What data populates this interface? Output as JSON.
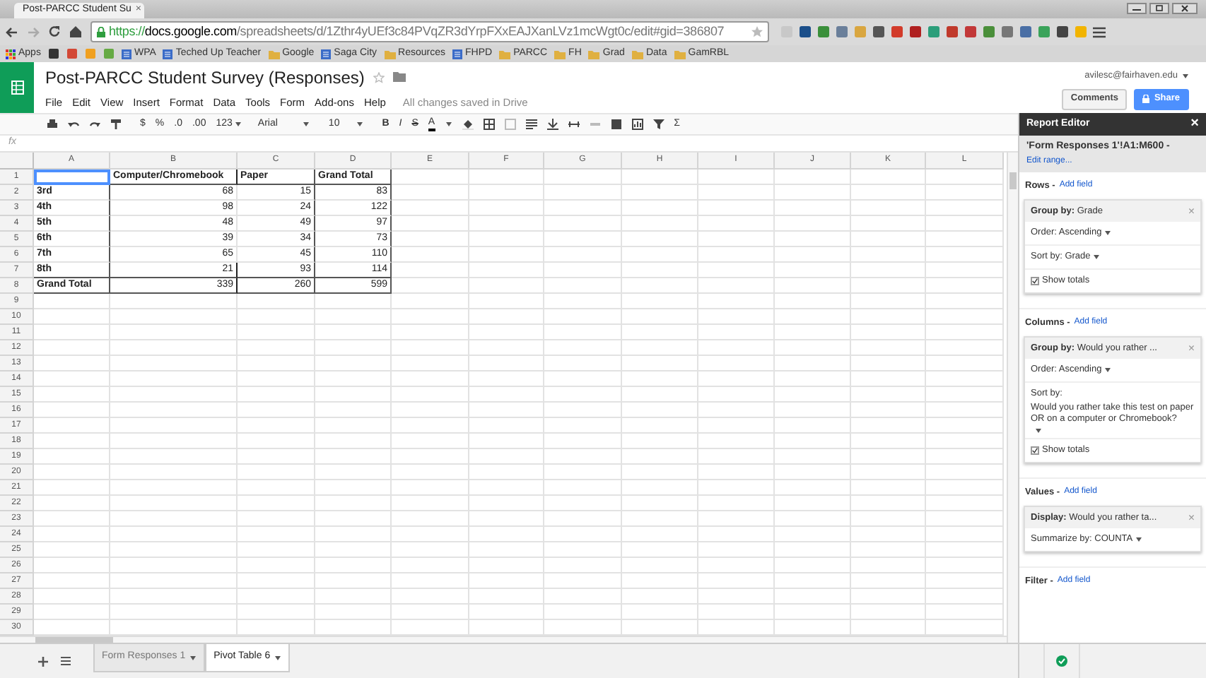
{
  "browser": {
    "tab_title": "Post-PARCC Student Su",
    "tab_close": "×",
    "url_scheme": "https://",
    "url_host": "docs.google.com",
    "url_path": "/spreadsheets/d/1Zthr4yUEf3c84PVqZR3dYrpFXxEAJXanLVz1mcWgt0c/edit#gid=386807",
    "bookmarks": [
      {
        "kind": "apps",
        "label": "Apps"
      },
      {
        "kind": "page",
        "label": "WPA"
      },
      {
        "kind": "page",
        "label": "Teched Up Teacher"
      },
      {
        "kind": "folder",
        "label": "Google"
      },
      {
        "kind": "page",
        "label": "Saga City"
      },
      {
        "kind": "folder",
        "label": "Resources"
      },
      {
        "kind": "page",
        "label": "FHPD"
      },
      {
        "kind": "folder",
        "label": "PARCC"
      },
      {
        "kind": "folder",
        "label": "FH"
      },
      {
        "kind": "folder",
        "label": "Grad"
      },
      {
        "kind": "folder",
        "label": "Data"
      },
      {
        "kind": "folder",
        "label": "GamRBL"
      }
    ]
  },
  "doc": {
    "title": "Post-PARCC Student Survey (Responses)",
    "menus": [
      "File",
      "Edit",
      "View",
      "Insert",
      "Format",
      "Data",
      "Tools",
      "Form",
      "Add-ons",
      "Help"
    ],
    "save_status": "All changes saved in Drive",
    "account": "avilesc@fairhaven.edu",
    "comments_button": "Comments",
    "share_button": "Share"
  },
  "toolbar": {
    "texts": [
      "$",
      "%",
      ".0",
      ".00",
      "123",
      "Arial",
      "10",
      "B",
      "I",
      "S",
      "A",
      "Σ"
    ]
  },
  "formula_bar": {
    "label": "fx"
  },
  "grid": {
    "columns": [
      "A",
      "B",
      "C",
      "D",
      "E",
      "F",
      "G",
      "H",
      "I",
      "J",
      "K",
      "L"
    ],
    "row_numbers": [
      "1",
      "2",
      "3",
      "4",
      "5",
      "6",
      "7",
      "8",
      "9",
      "10",
      "11",
      "12",
      "13",
      "14",
      "15",
      "16",
      "17",
      "18",
      "19",
      "20",
      "21",
      "22",
      "23",
      "24",
      "25",
      "26",
      "27",
      "28",
      "29",
      "30"
    ],
    "rows": [
      [
        {
          "selected": true
        },
        {
          "text": "Computer/Chromebook",
          "selected": false
        },
        {
          "text": "Paper",
          "selected": false
        },
        {
          "text": "Grand Total",
          "selected": false
        }
      ],
      [
        {
          "text": "3rd",
          "selected": false
        },
        {
          "text": "68",
          "selected": false
        },
        {
          "text": "15",
          "selected": false
        },
        {
          "text": "83",
          "selected": false
        }
      ],
      [
        {
          "text": "4th",
          "selected": false
        },
        {
          "text": "98",
          "selected": false
        },
        {
          "text": "24",
          "selected": false
        },
        {
          "text": "122",
          "selected": false
        }
      ],
      [
        {
          "text": "5th",
          "selected": false
        },
        {
          "text": "48",
          "selected": false
        },
        {
          "text": "49",
          "selected": false
        },
        {
          "text": "97",
          "selected": false
        }
      ],
      [
        {
          "text": "6th",
          "selected": false
        },
        {
          "text": "39",
          "selected": false
        },
        {
          "text": "34",
          "selected": false
        },
        {
          "text": "73",
          "selected": false
        }
      ],
      [
        {
          "text": "7th",
          "selected": false
        },
        {
          "text": "65",
          "selected": false
        },
        {
          "text": "45",
          "selected": false
        },
        {
          "text": "110",
          "selected": false
        }
      ],
      [
        {
          "text": "8th",
          "selected": false
        },
        {
          "text": "21",
          "selected": false
        },
        {
          "text": "93",
          "selected": false
        },
        {
          "text": "114",
          "selected": false
        }
      ],
      [
        {
          "text": "Grand Total",
          "selected": false
        },
        {
          "text": "339",
          "selected": false
        },
        {
          "text": "260",
          "selected": false
        },
        {
          "text": "599",
          "selected": false
        }
      ]
    ]
  },
  "report_editor": {
    "title": "Report Editor",
    "close": "×",
    "range": "'Form Responses 1'!A1:M600 -",
    "edit_range": "Edit range...",
    "sections": [
      {
        "label": "Rows -",
        "add_field": "Add field",
        "cards": [
          {
            "key": "Group by:",
            "value": "Grade",
            "close": "×",
            "lines": [
              {
                "kind": "dropdown",
                "text": "Order: Ascending"
              },
              {
                "kind": "dropdown",
                "text": "Sort by: Grade"
              },
              {
                "kind": "checkbox",
                "text": "Show totals",
                "checked": true
              }
            ]
          }
        ]
      },
      {
        "label": "Columns -",
        "add_field": "Add field",
        "cards": [
          {
            "key": "Group by:",
            "value": "Would you rather ...",
            "close": "×",
            "lines": [
              {
                "kind": "dropdown",
                "text": "Order: Ascending"
              },
              {
                "kind": "sort",
                "label": "Sort by:",
                "text": "Would you rather take this test on paper OR on a computer or Chromebook?"
              },
              {
                "kind": "checkbox",
                "text": "Show totals",
                "checked": true
              }
            ]
          }
        ]
      },
      {
        "label": "Values -",
        "add_field": "Add field",
        "cards": [
          {
            "key": "Display:",
            "value": "Would you rather ta...",
            "close": "×",
            "lines": [
              {
                "kind": "dropdown",
                "text": "Summarize by: COUNTA"
              }
            ]
          }
        ]
      },
      {
        "label": "Filter -",
        "add_field": "Add field"
      }
    ]
  },
  "sheet_tabs": [
    {
      "label": "Form Responses 1",
      "selected": false
    },
    {
      "label": "Pivot Table 6",
      "selected": true
    }
  ]
}
